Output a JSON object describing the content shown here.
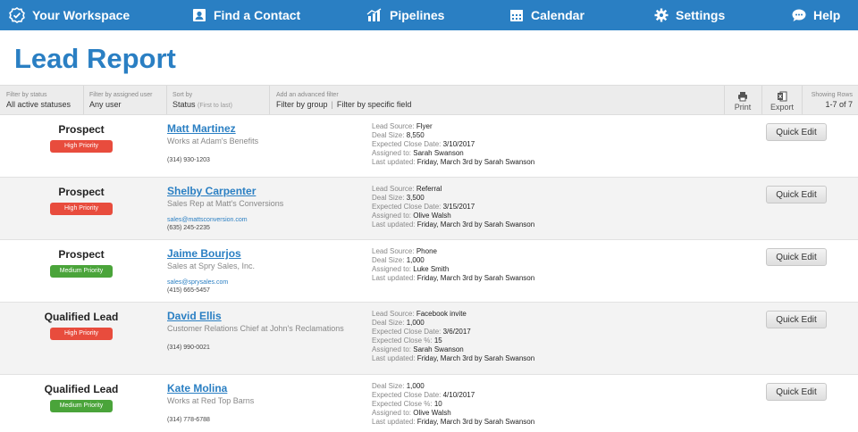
{
  "nav": {
    "workspace": "Your Workspace",
    "find_contact": "Find a Contact",
    "pipelines": "Pipelines",
    "calendar": "Calendar",
    "settings": "Settings",
    "help": "Help"
  },
  "page_title": "Lead Report",
  "filters": {
    "status": {
      "label": "Filter by status",
      "value": "All active statuses"
    },
    "assigned": {
      "label": "Filter by assigned user",
      "value": "Any user"
    },
    "sort": {
      "label": "Sort by",
      "value": "Status",
      "hint": "(First to last)"
    },
    "advanced": {
      "label": "Add an advanced filter",
      "group": "Filter by group",
      "separator": "|",
      "field": "Filter by specific field"
    }
  },
  "tools": {
    "print": "Print",
    "export": "Export"
  },
  "rows_info": {
    "label": "Showing Rows",
    "value": "1-7 of 7"
  },
  "quick_edit_label": "Quick Edit",
  "leads": [
    {
      "status": "Prospect",
      "priority": "High Priority",
      "name": "Matt Martinez",
      "subtitle": "Works at Adam's Benefits",
      "email": "",
      "phone": "(314) 930-1203",
      "details": [
        {
          "k": "Lead Source:",
          "v": "Flyer"
        },
        {
          "k": "Deal Size:",
          "v": "8,550"
        },
        {
          "k": "Expected Close Date:",
          "v": "3/10/2017"
        },
        {
          "k": "Assigned to:",
          "v": "Sarah Swanson"
        },
        {
          "k": "Last updated:",
          "v": "Friday, March 3rd by Sarah Swanson"
        }
      ]
    },
    {
      "status": "Prospect",
      "priority": "High Priority",
      "name": "Shelby Carpenter",
      "subtitle": "Sales Rep at Matt's Conversions",
      "email": "sales@mattsconversion.com",
      "phone": "(635) 245-2235",
      "details": [
        {
          "k": "Lead Source:",
          "v": "Referral"
        },
        {
          "k": "Deal Size:",
          "v": "3,500"
        },
        {
          "k": "Expected Close Date:",
          "v": "3/15/2017"
        },
        {
          "k": "Assigned to:",
          "v": "Olive Walsh"
        },
        {
          "k": "Last updated:",
          "v": "Friday, March 3rd by Sarah Swanson"
        }
      ]
    },
    {
      "status": "Prospect",
      "priority": "Medium Priority",
      "name": "Jaime Bourjos",
      "subtitle": "Sales at Spry Sales, Inc.",
      "email": "sales@sprysales.com",
      "phone": "(415) 665-5457",
      "details": [
        {
          "k": "Lead Source:",
          "v": "Phone"
        },
        {
          "k": "Deal Size:",
          "v": "1,000"
        },
        {
          "k": "Assigned to:",
          "v": "Luke Smith"
        },
        {
          "k": "Last updated:",
          "v": "Friday, March 3rd by Sarah Swanson"
        }
      ]
    },
    {
      "status": "Qualified Lead",
      "priority": "High Priority",
      "name": "David Ellis",
      "subtitle": "Customer Relations Chief at John's Reclamations",
      "email": "",
      "phone": "(314) 990-0021",
      "details": [
        {
          "k": "Lead Source:",
          "v": "Facebook invite"
        },
        {
          "k": "Deal Size:",
          "v": "1,000"
        },
        {
          "k": "Expected Close Date:",
          "v": "3/6/2017"
        },
        {
          "k": "Expected Close %:",
          "v": "15"
        },
        {
          "k": "Assigned to:",
          "v": "Sarah Swanson"
        },
        {
          "k": "Last updated:",
          "v": "Friday, March 3rd by Sarah Swanson"
        }
      ]
    },
    {
      "status": "Qualified Lead",
      "priority": "Medium Priority",
      "name": "Kate Molina",
      "subtitle": "Works at Red Top Barns",
      "email": "",
      "phone": "(314) 778-6788",
      "details": [
        {
          "k": "Deal Size:",
          "v": "1,000"
        },
        {
          "k": "Expected Close Date:",
          "v": "4/10/2017"
        },
        {
          "k": "Expected Close %:",
          "v": "10"
        },
        {
          "k": "Assigned to:",
          "v": "Olive Walsh"
        },
        {
          "k": "Last updated:",
          "v": "Friday, March 3rd by Sarah Swanson"
        }
      ]
    }
  ]
}
